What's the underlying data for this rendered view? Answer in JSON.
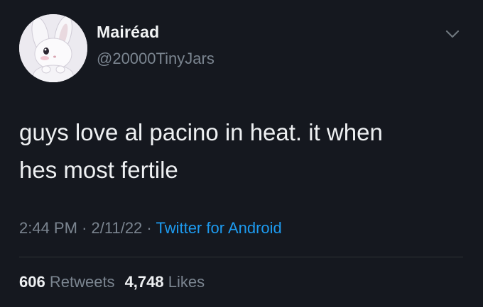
{
  "user": {
    "display_name": "Mairéad",
    "handle": "@20000TinyJars",
    "avatar_icon": "bunny-avatar"
  },
  "tweet": {
    "text_line1": "guys love al pacino in heat. it when",
    "text_line2": "hes most fertile",
    "time": "2:44 PM",
    "date": "2/11/22",
    "source": "Twitter for Android",
    "separator": "·"
  },
  "stats": {
    "retweets_count": "606",
    "retweets_label": "Retweets",
    "likes_count": "4,748",
    "likes_label": "Likes"
  },
  "colors": {
    "background": "#15181f",
    "link": "#1d9bf0",
    "muted": "#7b8590"
  }
}
